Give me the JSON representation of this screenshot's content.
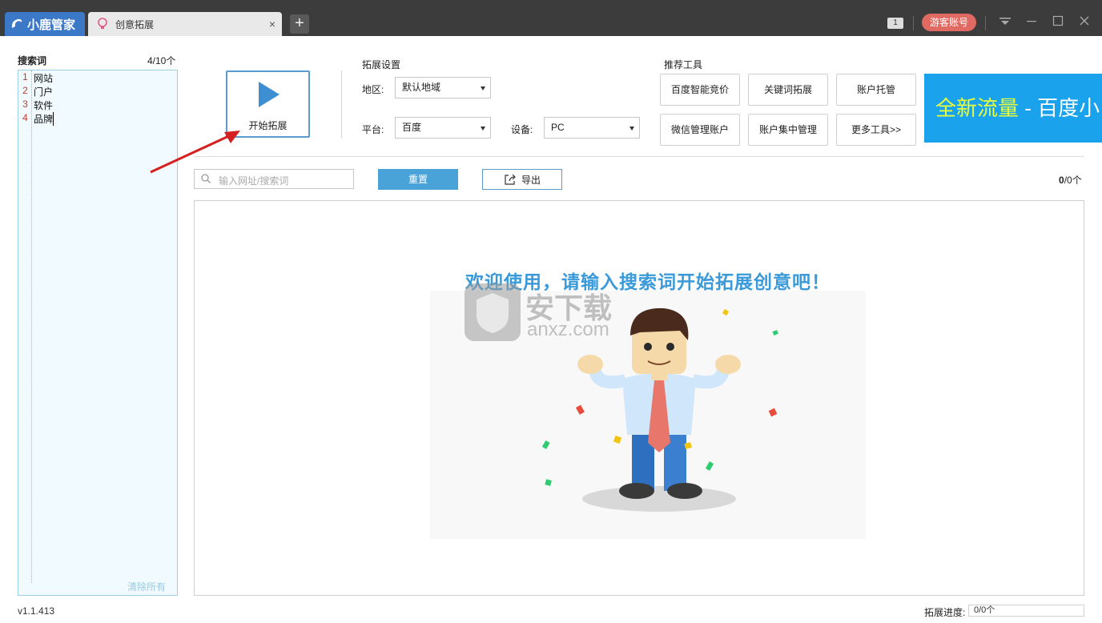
{
  "titlebar": {
    "brand": "小鹿管家",
    "tab_title": "创意拓展",
    "tab_close": "×",
    "new_tab": "+",
    "message_count": "1",
    "guest_account": "游客账号",
    "window_controls": [
      "dropdown-icon",
      "minimize-icon",
      "maximize-icon",
      "close-icon"
    ]
  },
  "keywords": {
    "title": "搜索词",
    "count": "4/10个",
    "items": [
      {
        "num": "1",
        "text": "网站"
      },
      {
        "num": "2",
        "text": "门户"
      },
      {
        "num": "3",
        "text": "软件"
      },
      {
        "num": "4",
        "text": "品牌"
      }
    ],
    "clear_all": "清除所有"
  },
  "version": "v1.1.413",
  "start_button": "开始拓展",
  "settings": {
    "title": "拓展设置",
    "region_label": "地区:",
    "region_value": "默认地域",
    "platform_label": "平台:",
    "platform_value": "百度",
    "device_label": "设备:",
    "device_value": "PC"
  },
  "tools": {
    "title": "推荐工具",
    "buttons": [
      "百度智能竞价",
      "关键词拓展",
      "账户托管",
      "微信管理账户",
      "账户集中管理",
      "更多工具>>"
    ]
  },
  "banner": {
    "highlight": "全新流量",
    "rest": " - 百度小"
  },
  "toolbar": {
    "search_placeholder": "输入网址/搜索词",
    "reset": "重置",
    "export": "导出",
    "count_bold": "0",
    "count_rest": "/0个"
  },
  "result": {
    "welcome": "欢迎使用，请输入搜索词开始拓展创意吧！"
  },
  "watermark": {
    "cn": "安下载",
    "en": "anxz.com"
  },
  "status": {
    "progress_label": "拓展进度:",
    "progress_value": "0/0个"
  },
  "colors": {
    "titlebar": "#3c3c3c",
    "brand": "#3b79c8",
    "accent": "#4aa3d8",
    "banner": "#1aa3ec",
    "guest": "#e06a62"
  }
}
